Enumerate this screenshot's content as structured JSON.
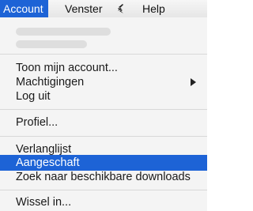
{
  "menubar": {
    "account": "Account",
    "venster": "Venster",
    "help": "Help",
    "script_icon": "script-icon"
  },
  "menu": {
    "items": [
      {
        "label": "Toon mijn account..."
      },
      {
        "label": "Machtigingen",
        "submenu": true
      },
      {
        "label": "Log uit"
      },
      {
        "label": "Profiel..."
      },
      {
        "label": "Verlanglijst"
      },
      {
        "label": "Aangeschaft",
        "highlighted": true
      },
      {
        "label": "Zoek naar beschikbare downloads"
      },
      {
        "label": "Wissel in..."
      }
    ]
  },
  "colors": {
    "highlight": "#1d63d6",
    "menu_background": "#f4f4f4"
  }
}
